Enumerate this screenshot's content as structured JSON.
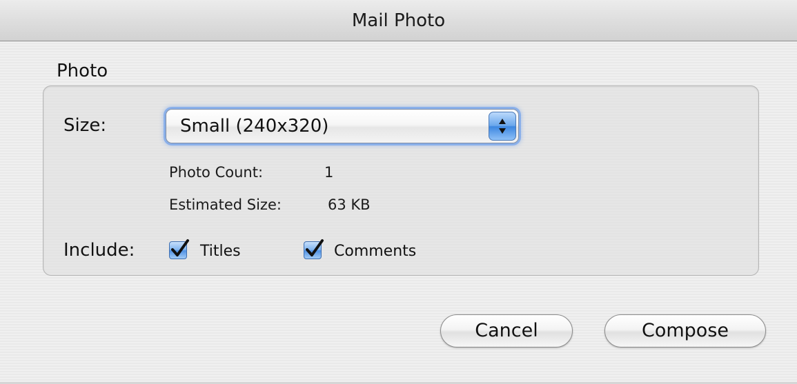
{
  "window": {
    "title": "Mail Photo"
  },
  "photo_group": {
    "label": "Photo",
    "size": {
      "label": "Size:",
      "selected": "Small (240x320)"
    },
    "photo_count": {
      "label": "Photo Count:",
      "value": "1"
    },
    "estimated_size": {
      "label": "Estimated Size:",
      "value": "63 KB"
    },
    "include": {
      "label": "Include:",
      "options": [
        {
          "label": "Titles",
          "checked": true
        },
        {
          "label": "Comments",
          "checked": true
        }
      ]
    }
  },
  "buttons": {
    "cancel": "Cancel",
    "compose": "Compose"
  },
  "colors": {
    "accent": "#4a8fe3",
    "window_bg": "#ececec"
  }
}
